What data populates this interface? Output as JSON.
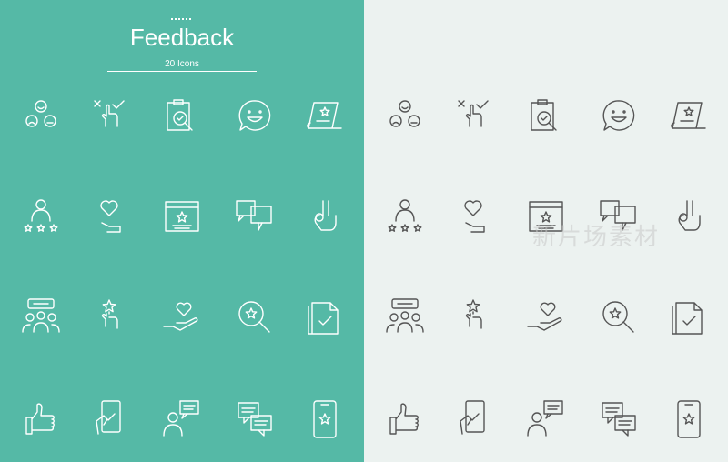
{
  "header": {
    "title": "Feedback",
    "subtitle": "20 Icons"
  },
  "colors": {
    "left_background": "#55b9a6",
    "right_background": "#ecf2f0",
    "left_stroke": "#ffffff",
    "right_stroke": "#555555"
  },
  "icons": [
    {
      "name": "satisfaction-faces-icon"
    },
    {
      "name": "reject-approve-tap-icon"
    },
    {
      "name": "clipboard-magnifier-check-icon"
    },
    {
      "name": "smile-speech-bubble-icon"
    },
    {
      "name": "star-certificate-scroll-icon"
    },
    {
      "name": "person-star-rating-icon"
    },
    {
      "name": "hand-holding-heart-icon"
    },
    {
      "name": "web-page-star-review-icon"
    },
    {
      "name": "multiple-speech-bubbles-icon"
    },
    {
      "name": "ok-hand-gesture-icon"
    },
    {
      "name": "group-discussion-icon"
    },
    {
      "name": "tap-star-icon"
    },
    {
      "name": "heart-on-palm-icon"
    },
    {
      "name": "magnifier-star-icon"
    },
    {
      "name": "document-check-icon"
    },
    {
      "name": "thumbs-up-icon"
    },
    {
      "name": "phone-in-hand-check-icon"
    },
    {
      "name": "person-speech-bubble-icon"
    },
    {
      "name": "chat-messages-icon"
    },
    {
      "name": "smartphone-star-icon"
    }
  ],
  "watermark": "新片场素材"
}
